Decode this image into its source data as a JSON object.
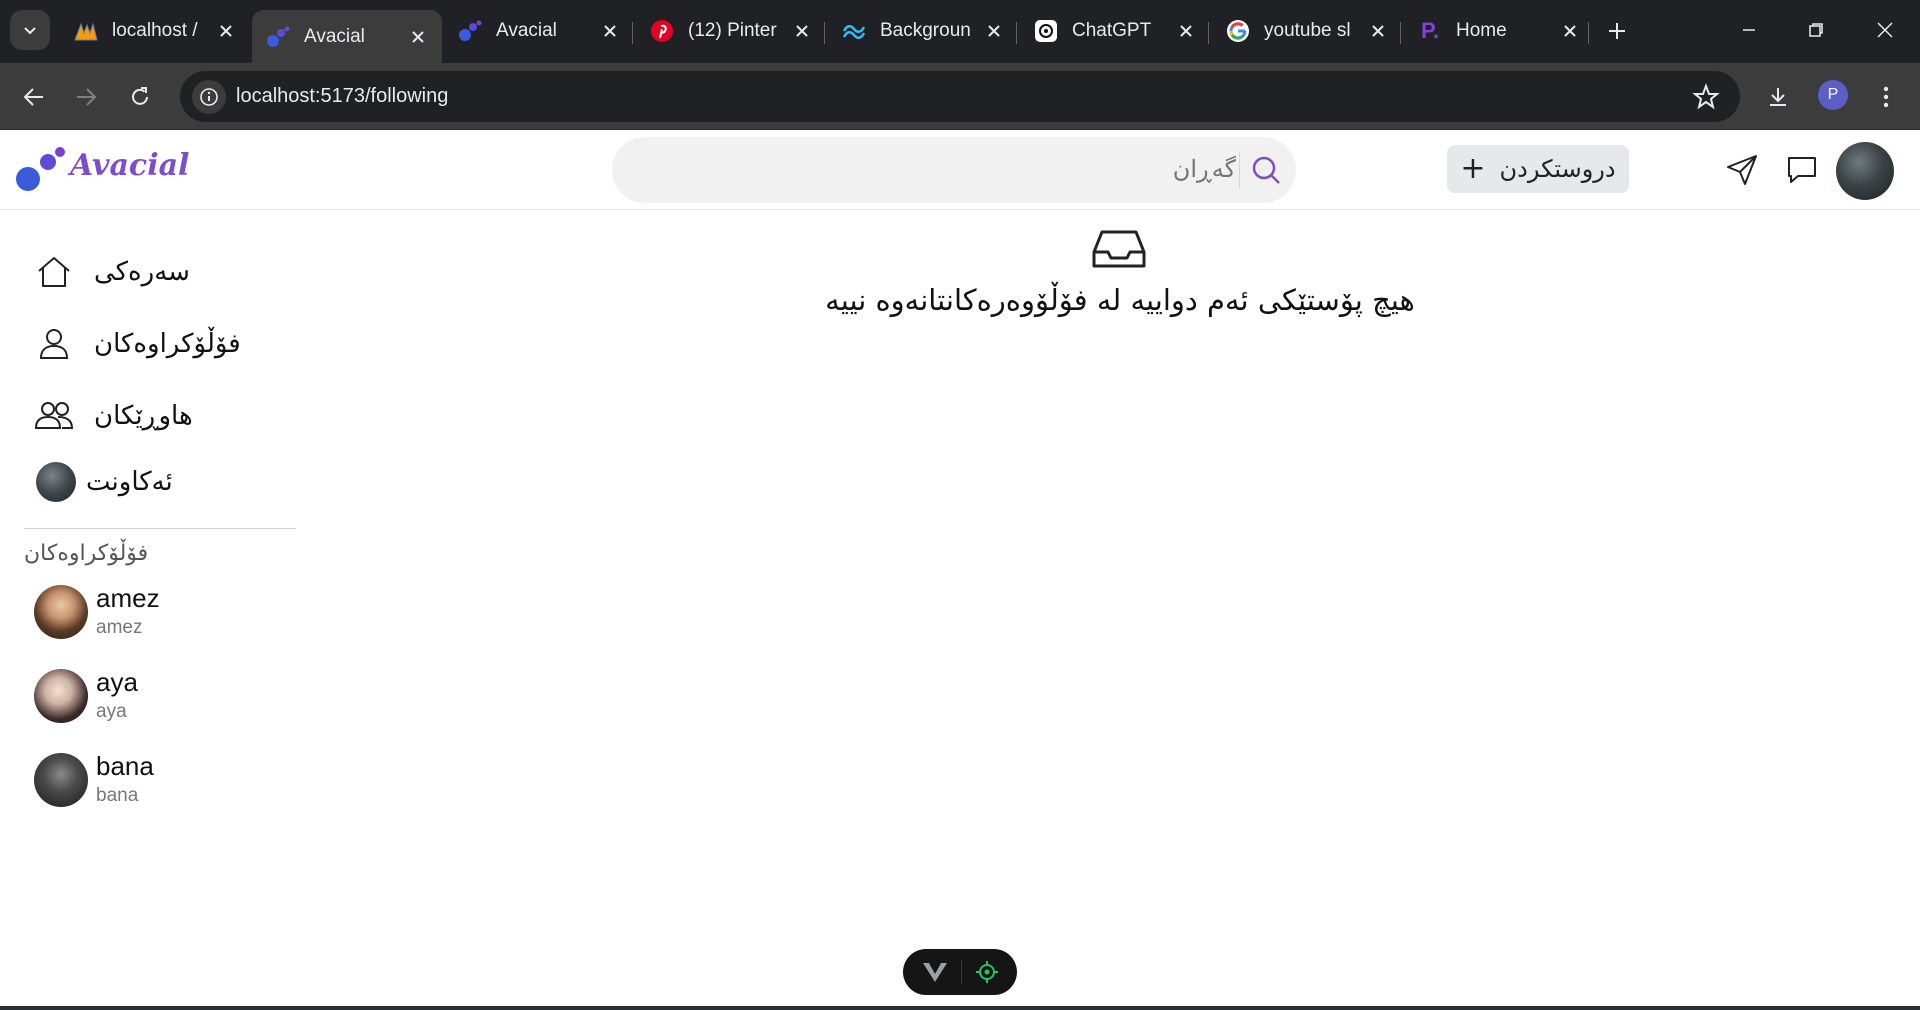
{
  "browser": {
    "tabs": [
      {
        "title": "localhost /",
        "icon": "phpmyadmin-icon",
        "active": false
      },
      {
        "title": "Avacial",
        "icon": "avacial-icon",
        "active": true
      },
      {
        "title": "Avacial",
        "icon": "avacial-icon",
        "active": false
      },
      {
        "title": "(12) Pinter",
        "icon": "pinterest-icon",
        "active": false
      },
      {
        "title": "Backgroun",
        "icon": "tailwind-icon",
        "active": false
      },
      {
        "title": "ChatGPT",
        "icon": "chatgpt-icon",
        "active": false
      },
      {
        "title": "youtube sl",
        "icon": "google-icon",
        "active": false
      },
      {
        "title": "Home",
        "icon": "p-logo-icon",
        "active": false
      }
    ],
    "url": "localhost:5173/following",
    "profile_initial": "P"
  },
  "header": {
    "brand": "Avacial",
    "search_placeholder": "گەڕان",
    "create_label": "دروستکردن",
    "create_plus": "+",
    "accent": "#7c4dcc"
  },
  "sidebar": {
    "nav": [
      {
        "label": "سەرەکی",
        "icon": "home-icon"
      },
      {
        "label": "فۆڵۆکراوەکان",
        "icon": "user-icon"
      },
      {
        "label": "هاوڕێکان",
        "icon": "users-icon"
      },
      {
        "label": "ئەکاونت",
        "icon": "avatar"
      }
    ],
    "section_title": "فۆڵۆکراوەکان",
    "following": [
      {
        "name": "amez",
        "username": "amez"
      },
      {
        "name": "aya",
        "username": "aya"
      },
      {
        "name": "bana",
        "username": "bana"
      }
    ]
  },
  "main": {
    "empty_message": "هیچ پۆستێکی ئەم دواییە لە فۆڵۆوەرەکانتانەوە نییە",
    "empty_icon": "inbox-icon"
  }
}
